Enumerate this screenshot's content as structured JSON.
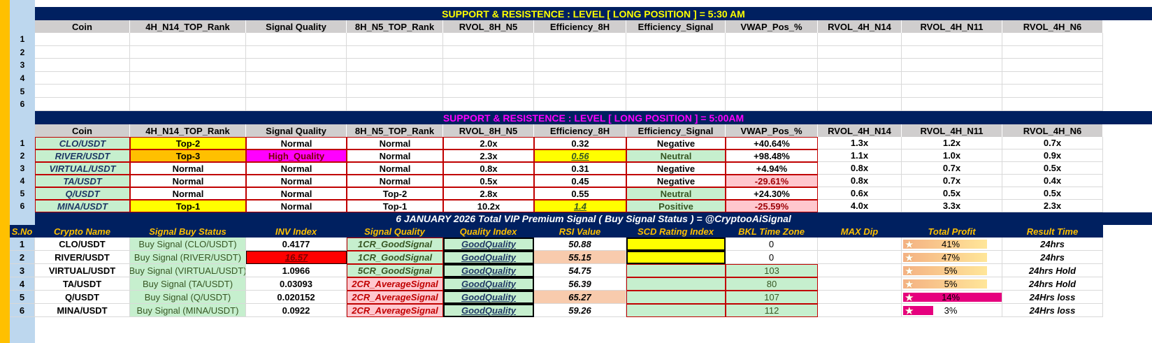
{
  "section1": {
    "title": "SUPPORT  &  RESISTENCE  :  LEVEL    [   LONG   POSITION   ]      =      5:30 AM",
    "headers": [
      "Coin",
      "4H_N14_TOP_Rank",
      "Signal Quality",
      "8H_N5_TOP_Rank",
      "RVOL_8H_N5",
      "Efficiency_8H",
      "Efficiency_Signal",
      "VWAP_Pos_%",
      "RVOL_4H_N14",
      "RVOL_4H_N11",
      "RVOL_4H_N6"
    ],
    "row_numbers": [
      "1",
      "2",
      "3",
      "4",
      "5",
      "6"
    ]
  },
  "section2": {
    "title": "SUPPORT  &  RESISTENCE  :  LEVEL    [   LONG   POSITION   ]      =      5:00AM",
    "headers": [
      "Coin",
      "4H_N14_TOP_Rank",
      "Signal Quality",
      "8H_N5_TOP_Rank",
      "RVOL_8H_N5",
      "Efficiency_8H",
      "Efficiency_Signal",
      "VWAP_Pos_%",
      "RVOL_4H_N14",
      "RVOL_4H_N11",
      "RVOL_4H_N6"
    ],
    "rows": [
      {
        "n": "1",
        "coin": "CLO/USDT",
        "r4h": "Top-2",
        "sq": "Normal",
        "r8h": "Normal",
        "rvol8": "2.0x",
        "eff": "0.32",
        "effsig": "Negative",
        "vwap": "+40.64%",
        "rv14": "1.3x",
        "rv11": "1.2x",
        "rv6": "0.7x"
      },
      {
        "n": "2",
        "coin": "RIVER/USDT",
        "r4h": "Top-3",
        "sq": "High_Quality",
        "r8h": "Normal",
        "rvol8": "2.3x",
        "eff": "0.56",
        "effsig": "Neutral",
        "vwap": "+98.48%",
        "rv14": "1.1x",
        "rv11": "1.0x",
        "rv6": "0.9x"
      },
      {
        "n": "3",
        "coin": "VIRTUAL/USDT",
        "r4h": "Normal",
        "sq": "Normal",
        "r8h": "Normal",
        "rvol8": "0.8x",
        "eff": "0.31",
        "effsig": "Negative",
        "vwap": "+4.94%",
        "rv14": "0.8x",
        "rv11": "0.7x",
        "rv6": "0.5x"
      },
      {
        "n": "4",
        "coin": "TA/USDT",
        "r4h": "Normal",
        "sq": "Normal",
        "r8h": "Normal",
        "rvol8": "0.5x",
        "eff": "0.45",
        "effsig": "Negative",
        "vwap": "-29.61%",
        "rv14": "0.8x",
        "rv11": "0.7x",
        "rv6": "0.4x"
      },
      {
        "n": "5",
        "coin": "Q/USDT",
        "r4h": "Normal",
        "sq": "Normal",
        "r8h": "Top-2",
        "rvol8": "2.8x",
        "eff": "0.55",
        "effsig": "Neutral",
        "vwap": "+24.30%",
        "rv14": "0.6x",
        "rv11": "0.5x",
        "rv6": "0.5x"
      },
      {
        "n": "6",
        "coin": "MINA/USDT",
        "r4h": "Top-1",
        "sq": "Normal",
        "r8h": "Top-1",
        "rvol8": "10.2x",
        "eff": "1.4",
        "effsig": "Positive",
        "vwap": "-25.59%",
        "rv14": "4.0x",
        "rv11": "3.3x",
        "rv6": "2.3x"
      }
    ]
  },
  "section3": {
    "title": "6  JANUARY   2026   Total VIP Premium Signal  ( Buy Signal Status )   =   @CryptooAiSignal",
    "headers": [
      "S.No",
      "Crypto Name",
      "Signal Buy Status",
      "INV  Index",
      "Signal Quality",
      "Quality Index",
      "RSI Value",
      "SCD  Rating Index",
      "BKL Time Zone",
      "MAX Dip",
      "Total Profit",
      "Result Time"
    ],
    "rows": [
      {
        "n": "1",
        "name": "CLO/USDT",
        "status": "Buy Signal (CLO/USDT)",
        "inv": "0.4177",
        "sq": "1CR_GoodSignal",
        "qi": "GoodQuality",
        "rsi": "50.88",
        "bkl": "0",
        "profit": "41%",
        "profit_frac": 0.41,
        "result": "24hrs"
      },
      {
        "n": "2",
        "name": "RIVER/USDT",
        "status": "Buy Signal (RIVER/USDT)",
        "inv": "16.57",
        "sq": "1CR_GoodSignal",
        "qi": "GoodQuality",
        "rsi": "55.15",
        "bkl": "0",
        "profit": "47%",
        "profit_frac": 0.47,
        "result": "24hrs"
      },
      {
        "n": "3",
        "name": "VIRTUAL/USDT",
        "status": "Buy Signal (VIRTUAL/USDT)",
        "inv": "1.0966",
        "sq": "5CR_GoodSignal",
        "qi": "GoodQuality",
        "rsi": "54.75",
        "bkl": "103",
        "profit": "5%",
        "profit_frac": 0.05,
        "result": "24hrs Hold"
      },
      {
        "n": "4",
        "name": "TA/USDT",
        "status": "Buy Signal (TA/USDT)",
        "inv": "0.03093",
        "sq": "2CR_AverageSignal",
        "qi": "GoodQuality",
        "rsi": "56.39",
        "bkl": "80",
        "profit": "5%",
        "profit_frac": 0.05,
        "result": "24hrs Hold"
      },
      {
        "n": "5",
        "name": "Q/USDT",
        "status": "Buy Signal (Q/USDT)",
        "inv": "0.020152",
        "sq": "2CR_AverageSignal",
        "qi": "GoodQuality",
        "rsi": "65.27",
        "bkl": "107",
        "profit": "14%",
        "profit_frac": 0.14,
        "result": "24Hrs loss"
      },
      {
        "n": "6",
        "name": "MINA/USDT",
        "status": "Buy Signal (MINA/USDT)",
        "inv": "0.0922",
        "sq": "2CR_AverageSignal",
        "qi": "GoodQuality",
        "rsi": "59.26",
        "bkl": "112",
        "profit": "3%",
        "profit_frac": 0.03,
        "result": "24Hrs loss"
      }
    ]
  },
  "colors": {
    "navy": "#002060",
    "yellow_text": "#ffff00",
    "magenta_text": "#ff00ff",
    "light_green": "#c6efce",
    "yellow": "#ffff00",
    "orange": "#ffc000",
    "pink": "#ffc7ce",
    "magenta": "#ff00ff",
    "red": "#ff0000",
    "salmon": "#f8cbad",
    "rose": "#e6007e"
  }
}
